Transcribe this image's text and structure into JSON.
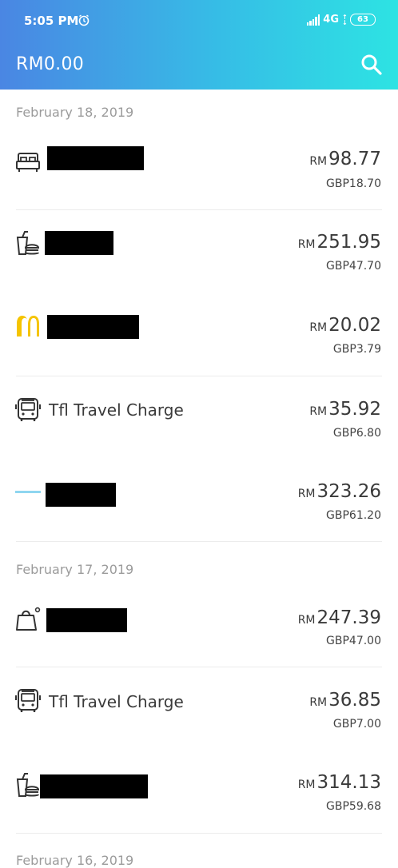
{
  "status": {
    "time": "5:05 PM",
    "network": "4G",
    "battery": "63"
  },
  "header": {
    "balance": "RM0.00"
  },
  "dates": [
    "February 18, 2019",
    "February 17, 2019",
    "February 16, 2019"
  ],
  "transactions": [
    {
      "icon": "bed-icon",
      "name": "",
      "currency": "RM",
      "amount": "98.77",
      "sub": "GBP18.70"
    },
    {
      "icon": "fast-food-icon",
      "name": "",
      "currency": "RM",
      "amount": "251.95",
      "sub": "GBP47.70"
    },
    {
      "icon": "mcdonalds-logo-icon",
      "name": "",
      "currency": "RM",
      "amount": "20.02",
      "sub": "GBP3.79"
    },
    {
      "icon": "bus-icon",
      "name": "Tfl Travel Charge",
      "currency": "RM",
      "amount": "35.92",
      "sub": "GBP6.80"
    },
    {
      "icon": "merchant-logo-icon",
      "name": "",
      "currency": "RM",
      "amount": "323.26",
      "sub": "GBP61.20"
    },
    {
      "icon": "shopping-bag-icon",
      "name": "",
      "currency": "RM",
      "amount": "247.39",
      "sub": "GBP47.00"
    },
    {
      "icon": "bus-icon",
      "name": "Tfl Travel Charge",
      "currency": "RM",
      "amount": "36.85",
      "sub": "GBP7.00"
    },
    {
      "icon": "fast-food-icon",
      "name": "",
      "currency": "RM",
      "amount": "314.13",
      "sub": "GBP59.68"
    }
  ],
  "colors": {
    "header_start": "#4a86e3",
    "header_end": "#2de3e3",
    "mcdonalds": "#f5c400"
  }
}
